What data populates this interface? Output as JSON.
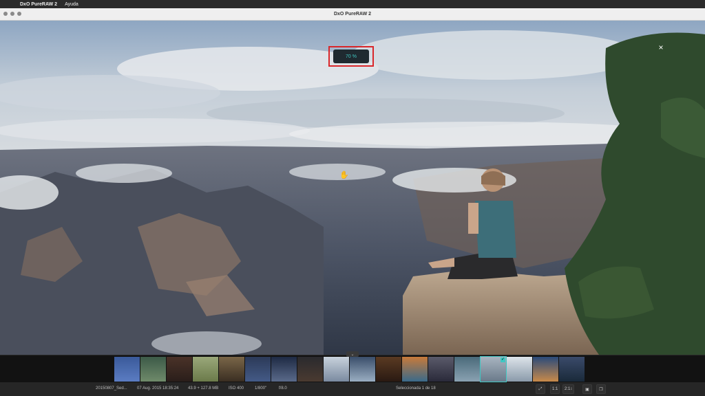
{
  "menubar": {
    "app_name": "DxO PureRAW 2",
    "items": [
      "Ayuda"
    ]
  },
  "window": {
    "title": "DxO PureRAW 2"
  },
  "viewer": {
    "zoom_label": "70 %",
    "close_label": "×"
  },
  "filmstrip": {
    "collapse_label": "⌄",
    "selected_index": 14,
    "thumbnail_count": 18
  },
  "status": {
    "filename": "20150807_Sed...",
    "date": "07 Aug. 2015 18:35:24",
    "size": "43.9 + 127.8 MB",
    "iso": "ISO 400",
    "shutter": "1/800\"",
    "aperture": "f/8.0",
    "selection": "Seleccionada 1 de 18",
    "zoom_fit": "1:1",
    "zoom_ratio": "2:1"
  },
  "colors": {
    "accent": "#3fc7c2",
    "highlight": "#d9262a"
  }
}
